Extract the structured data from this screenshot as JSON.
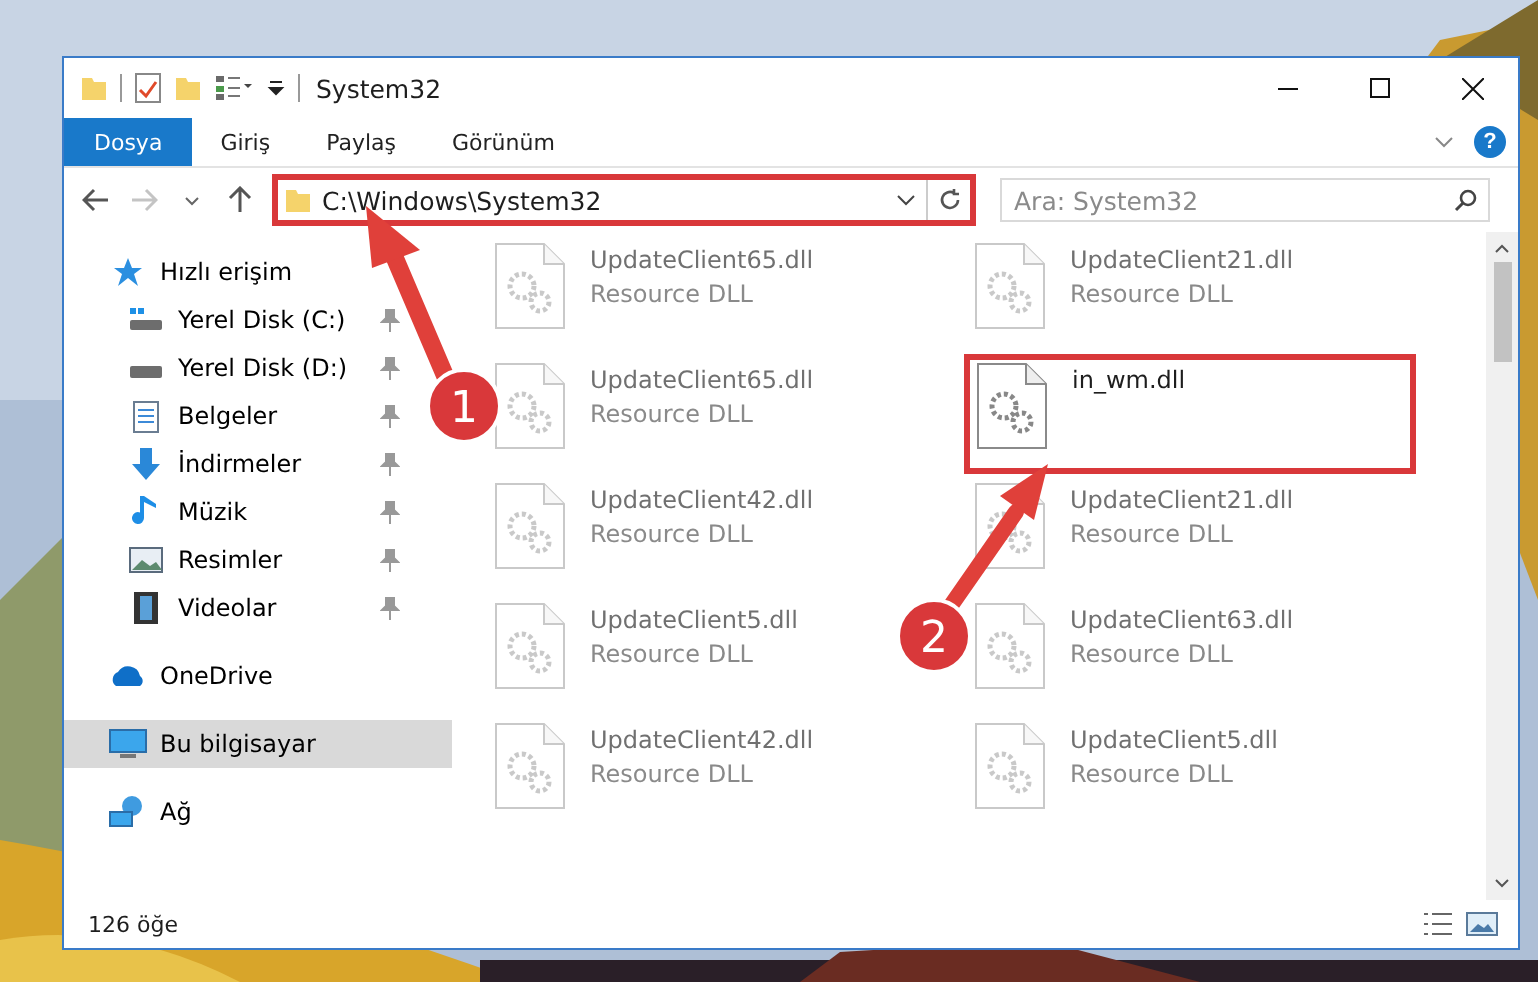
{
  "window": {
    "title": "System32",
    "help_label": "?"
  },
  "ribbon_tabs": [
    {
      "label": "Dosya",
      "selected": true
    },
    {
      "label": "Giriş",
      "selected": false
    },
    {
      "label": "Paylaş",
      "selected": false
    },
    {
      "label": "Görünüm",
      "selected": false
    }
  ],
  "address_bar": {
    "path": "C:\\Windows\\System32",
    "highlighted": true
  },
  "search": {
    "placeholder": "Ara: System32"
  },
  "nav_tree": [
    {
      "label": "Hızlı erişim",
      "kind": "star",
      "selected": false,
      "children": [
        {
          "label": "Yerel Disk (C:)",
          "kind": "drive-c",
          "pinned": true,
          "selected": false
        },
        {
          "label": "Yerel Disk (D:)",
          "kind": "drive",
          "pinned": true,
          "selected": false
        },
        {
          "label": "Belgeler",
          "kind": "document",
          "pinned": true,
          "selected": false
        },
        {
          "label": "İndirmeler",
          "kind": "download",
          "pinned": true,
          "selected": false
        },
        {
          "label": "Müzik",
          "kind": "music",
          "pinned": true,
          "selected": false
        },
        {
          "label": "Resimler",
          "kind": "pictures",
          "pinned": true,
          "selected": false
        },
        {
          "label": "Videolar",
          "kind": "videos",
          "pinned": true,
          "selected": false
        }
      ]
    },
    {
      "label": "OneDrive",
      "kind": "cloud",
      "selected": false
    },
    {
      "label": "Bu bilgisayar",
      "kind": "computer",
      "selected": true
    },
    {
      "label": "Ağ",
      "kind": "network",
      "selected": false
    }
  ],
  "files": [
    {
      "name": "UpdateClient65.dll",
      "type": "Resource DLL",
      "blurred": true,
      "highlighted": false
    },
    {
      "name": "UpdateClient21.dll",
      "type": "Resource DLL",
      "blurred": true,
      "highlighted": false
    },
    {
      "name": "UpdateClient65.dll",
      "type": "Resource DLL",
      "blurred": true,
      "highlighted": false
    },
    {
      "name": "in_wm.dll",
      "blurred": false,
      "highlighted": true
    },
    {
      "name": "UpdateClient42.dll",
      "type": "Resource DLL",
      "blurred": true,
      "highlighted": false
    },
    {
      "name": "UpdateClient21.dll",
      "type": "Resource DLL",
      "blurred": true,
      "highlighted": false
    },
    {
      "name": "UpdateClient5.dll",
      "type": "Resource DLL",
      "blurred": true,
      "highlighted": false
    },
    {
      "name": "UpdateClient63.dll",
      "type": "Resource DLL",
      "blurred": true,
      "highlighted": false
    },
    {
      "name": "UpdateClient42.dll",
      "type": "Resource DLL",
      "blurred": true,
      "highlighted": false
    },
    {
      "name": "UpdateClient5.dll",
      "type": "Resource DLL",
      "blurred": true,
      "highlighted": false
    }
  ],
  "status_bar": {
    "item_count": "126 öğe"
  },
  "annotations": [
    {
      "label": "1"
    },
    {
      "label": "2"
    }
  ]
}
